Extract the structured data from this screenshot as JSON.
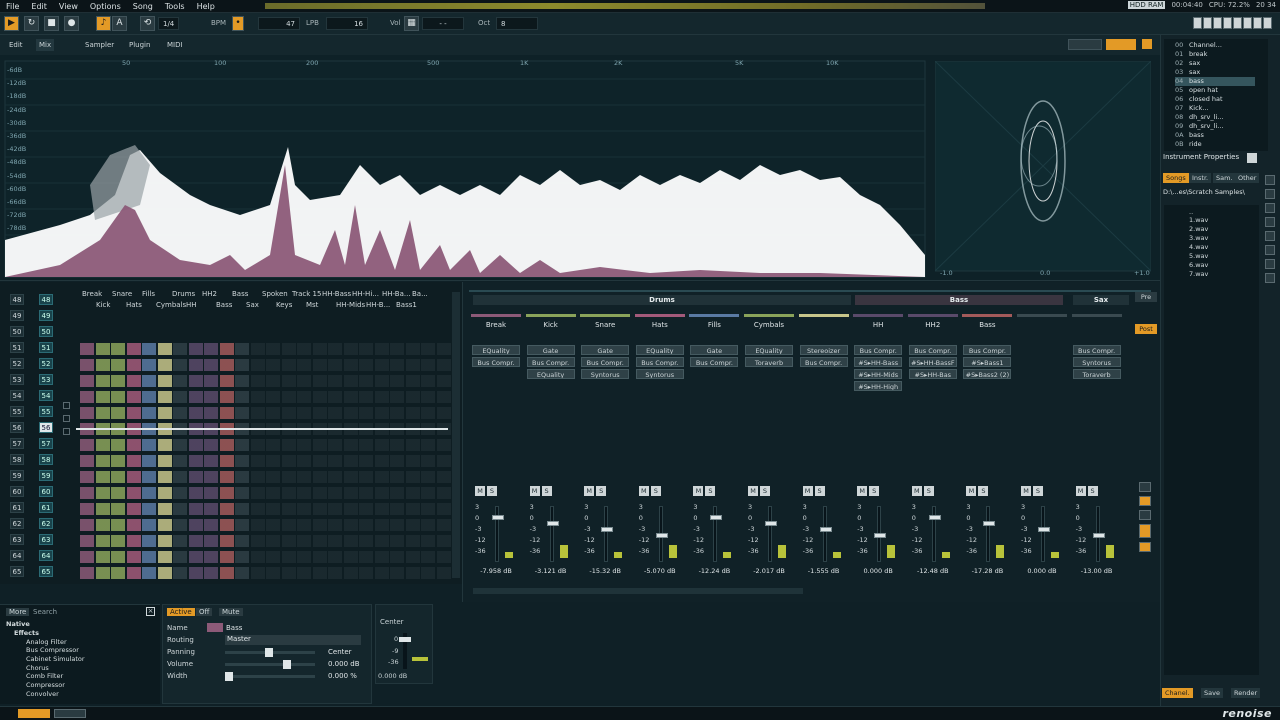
{
  "menu": [
    "File",
    "Edit",
    "View",
    "Options",
    "Song",
    "Tools",
    "Help"
  ],
  "status": {
    "time": "00:04:40",
    "cpu": "CPU: 72.2%",
    "clock": "20 34",
    "lcd": "HDD RAM"
  },
  "transport": {
    "pattern_step": "1/4",
    "bpm_label": "BPM",
    "bpm": "47",
    "lpb_label": "LPB",
    "lpb": "16",
    "vol_label": "Vol",
    "vol_value": "- -",
    "oct_label": "Oct",
    "oct": "8"
  },
  "modes": [
    "Edit",
    "Mix",
    "Sampler",
    "Plugin",
    "MIDI"
  ],
  "spectrum": {
    "freq_labels": [
      "50",
      "100",
      "200",
      "500",
      "1K",
      "2K",
      "5K",
      "10K"
    ],
    "db_labels": [
      "-6dB",
      "-12dB",
      "-18dB",
      "-24dB",
      "-30dB",
      "-36dB",
      "-42dB",
      "-48dB",
      "-54dB",
      "-60dB",
      "-66dB",
      "-72dB",
      "-78dB"
    ],
    "scope_labels": [
      "-1.0",
      "0.0",
      "+1.0"
    ]
  },
  "instruments": [
    {
      "num": "00",
      "name": "Channel..."
    },
    {
      "num": "01",
      "name": "break"
    },
    {
      "num": "02",
      "name": "sax"
    },
    {
      "num": "03",
      "name": "sax"
    },
    {
      "num": "04",
      "name": "bass"
    },
    {
      "num": "05",
      "name": "open hat"
    },
    {
      "num": "06",
      "name": "closed hat"
    },
    {
      "num": "07",
      "name": "Kick..."
    },
    {
      "num": "08",
      "name": "dh_srv_li..."
    },
    {
      "num": "09",
      "name": "dh_srv_li..."
    },
    {
      "num": "0A",
      "name": "bass"
    },
    {
      "num": "0B",
      "name": "ride"
    }
  ],
  "instr_props": {
    "title": "Instrument Properties",
    "tabs": [
      "Songs",
      "Instr.",
      "Sam.",
      "Other"
    ],
    "path": "D:\\...es\\Scratch Samples\\",
    "files": [
      "..",
      "1.wav",
      "2.wav",
      "3.wav",
      "4.wav",
      "5.wav",
      "6.wav",
      "7.wav"
    ],
    "bottom_buttons": [
      "Chanel.",
      "Save",
      "Render"
    ]
  },
  "pattern": {
    "seq": [
      "48",
      "49",
      "50",
      "51",
      "52",
      "53",
      "54",
      "55",
      "56",
      "57",
      "58",
      "59",
      "60",
      "61",
      "62",
      "63",
      "64",
      "65"
    ],
    "tracks_row1": [
      "Break",
      "Snare",
      "Fills",
      "Drums",
      "HH2",
      "Bass",
      "Spoken",
      "Track 15",
      "HH-Bass",
      "HH-Hi...",
      "HH-Ba...",
      "Ba..."
    ],
    "tracks_row2": [
      "Kick",
      "Hats",
      "Cymbals",
      "HH",
      "Bass",
      "Sax",
      "Keys",
      "Mst",
      "HH-Mids",
      "HH-B...",
      "Bass1"
    ]
  },
  "mixer": {
    "groups": [
      "Drums",
      "Bass",
      "Sax"
    ],
    "channels": [
      {
        "name": "Break",
        "db": "-7.958 dB",
        "fx": [
          "EQuality",
          "Bus Compr."
        ]
      },
      {
        "name": "Kick",
        "db": "-3.121 dB",
        "fx": [
          "Gate",
          "Bus Compr.",
          "EQuality"
        ]
      },
      {
        "name": "Snare",
        "db": "-15.32 dB",
        "fx": [
          "Gate",
          "Bus Compr.",
          "Syntorus"
        ]
      },
      {
        "name": "Hats",
        "db": "-5.070 dB",
        "fx": [
          "EQuality",
          "Bus Compr.",
          "Syntorus"
        ]
      },
      {
        "name": "Fills",
        "db": "-12.24 dB",
        "fx": [
          "Gate",
          "Bus Compr."
        ]
      },
      {
        "name": "Cymbals",
        "db": "-2.017 dB",
        "fx": [
          "EQuality",
          "Toraverb"
        ]
      },
      {
        "name": "",
        "db": "-1.555 dB",
        "fx": [
          "Stereoizer",
          "Bus Compr."
        ]
      },
      {
        "name": "HH",
        "db": "0.000 dB",
        "fx": [
          "Bus Compr.",
          "#S▸HH-Bass",
          "#S▸HH-Mids",
          "#S▸HH-High"
        ]
      },
      {
        "name": "HH2",
        "db": "-12.48 dB",
        "fx": [
          "Bus Compr.",
          "#S▸HH-BassF",
          "#S▸HH-Bas"
        ]
      },
      {
        "name": "Bass",
        "db": "-17.28 dB",
        "fx": [
          "Bus Compr.",
          "#S▸Bass1",
          "#S▸Bass2 (2)"
        ]
      },
      {
        "name": "",
        "db": "0.000 dB",
        "fx": []
      },
      {
        "name": "",
        "db": "-13.00 dB",
        "fx": [
          "Bus Compr.",
          "Syntorus",
          "Toraverb"
        ]
      }
    ],
    "meter_scale": [
      "3",
      "0",
      "-3",
      "-12",
      "-36"
    ],
    "side_labels": [
      "Pre",
      "Post"
    ]
  },
  "browser": {
    "tabs": [
      "More",
      "Search"
    ],
    "tree": [
      "Native",
      "Effects",
      "Analog Filter",
      "Bus Compressor",
      "Cabinet Simulator",
      "Chorus",
      "Comb Filter",
      "Compressor",
      "Convolver"
    ]
  },
  "trackprops": {
    "buttons": [
      "Active",
      "Off",
      "Mute"
    ],
    "name_label": "Name",
    "name": "Bass",
    "routing_label": "Routing",
    "routing": "Master",
    "panning_label": "Panning",
    "panning": "Center",
    "volume_label": "Volume",
    "volume": "0.000 dB",
    "width_label": "Width",
    "width": "0.000 %"
  },
  "panbox": {
    "title": "Center",
    "scale": [
      "0",
      "-9",
      "-36"
    ],
    "db": "0.000 dB"
  },
  "logo": "renoise",
  "colors": {
    "accent": "#e39a26",
    "spectrum_fill": "#ffffff",
    "spectrum_sub": "#8c5a78",
    "bg": "#0f2026"
  }
}
